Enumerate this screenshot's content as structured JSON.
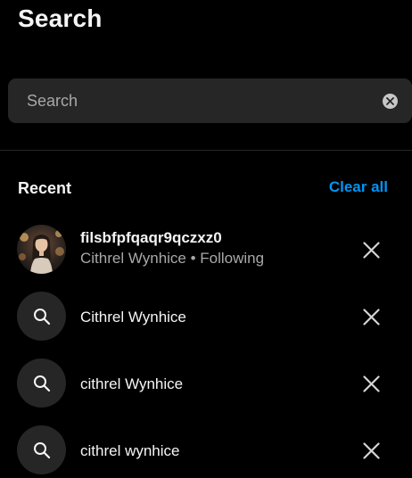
{
  "header": {
    "title": "Search"
  },
  "search": {
    "placeholder": "Search",
    "value": ""
  },
  "recent": {
    "heading": "Recent",
    "clear_all_label": "Clear all",
    "items": [
      {
        "kind": "account",
        "title": "filsbfpfqaqr9qczxz0",
        "subtitle": "Cithrel Wynhice • Following",
        "icon": "avatar"
      },
      {
        "kind": "query",
        "title": "Cithrel Wynhice",
        "icon": "search-icon"
      },
      {
        "kind": "query",
        "title": "cithrel Wynhice",
        "icon": "search-icon"
      },
      {
        "kind": "query",
        "title": "cithrel wynhice",
        "icon": "search-icon"
      }
    ]
  },
  "colors": {
    "background": "#000000",
    "surface": "#262626",
    "text_primary": "#f5f5f5",
    "text_secondary": "#a8a8a8",
    "accent": "#0095f6"
  }
}
